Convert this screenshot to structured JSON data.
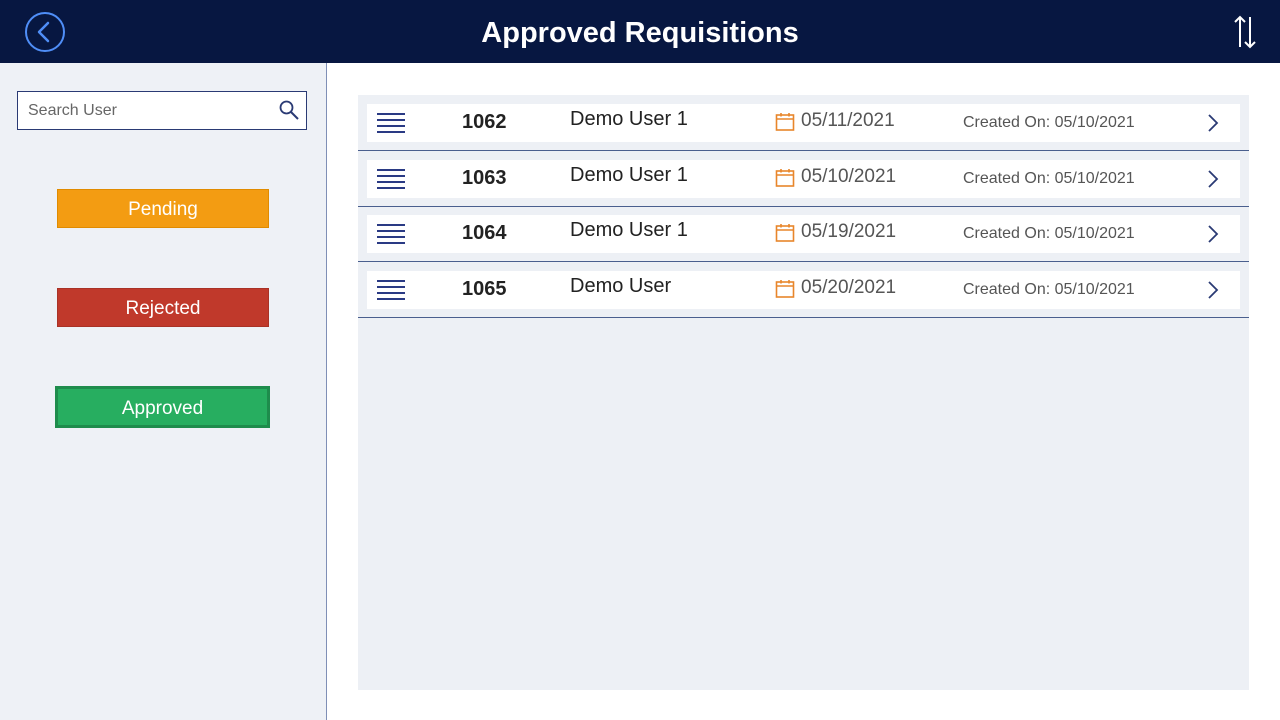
{
  "header": {
    "title": "Approved Requisitions",
    "back_icon": "chevron-left-circle-icon",
    "sort_icon": "sort-arrows-icon",
    "background_color": "#071741"
  },
  "sidebar": {
    "search": {
      "placeholder": "Search User",
      "value": "",
      "icon": "search-icon"
    },
    "filters": {
      "pending": {
        "label": "Pending",
        "color": "#f39c12"
      },
      "rejected": {
        "label": "Rejected",
        "color": "#c0392b"
      },
      "approved": {
        "label": "Approved",
        "color": "#27ae60",
        "selected": true
      }
    }
  },
  "requisitions": [
    {
      "id": "1062",
      "user": "Demo User 1",
      "date": "05/11/2021",
      "created": "Created On: 05/10/2021"
    },
    {
      "id": "1063",
      "user": "Demo User 1",
      "date": "05/10/2021",
      "created": "Created On: 05/10/2021"
    },
    {
      "id": "1064",
      "user": "Demo User 1",
      "date": "05/19/2021",
      "created": "Created On: 05/10/2021"
    },
    {
      "id": "1065",
      "user": "Demo User",
      "date": "05/20/2021",
      "created": "Created On: 05/10/2021"
    }
  ],
  "icons": {
    "row_leading": "list-icon",
    "date": "calendar-icon",
    "row_trailing": "chevron-right-icon"
  },
  "colors": {
    "accent_orange": "#e8862b",
    "nav_blue": "#071741"
  }
}
